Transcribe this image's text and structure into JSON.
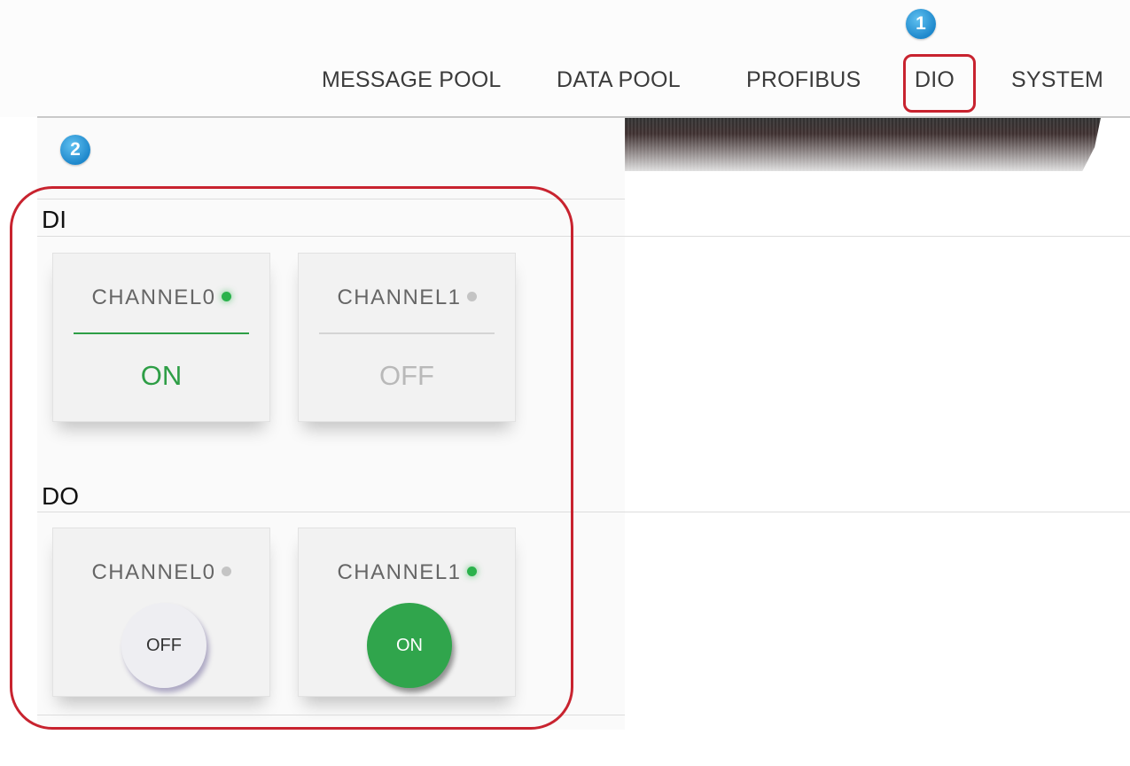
{
  "nav": {
    "items": [
      "MESSAGE POOL",
      "DATA POOL",
      "PROFIBUS",
      "DIO",
      "SYSTEM"
    ],
    "active": "DIO"
  },
  "markers": [
    "1",
    "2"
  ],
  "di": {
    "title": "DI",
    "channels": [
      {
        "name": "CHANNEL0",
        "state": "ON"
      },
      {
        "name": "CHANNEL1",
        "state": "OFF"
      }
    ]
  },
  "do": {
    "title": "DO",
    "channels": [
      {
        "name": "CHANNEL0",
        "state": "OFF"
      },
      {
        "name": "CHANNEL1",
        "state": "ON"
      }
    ]
  },
  "colors": {
    "on": "#2e9e46",
    "off_text": "#b9b9b9",
    "highlight": "#c8232f",
    "marker": "#1e88cc"
  }
}
